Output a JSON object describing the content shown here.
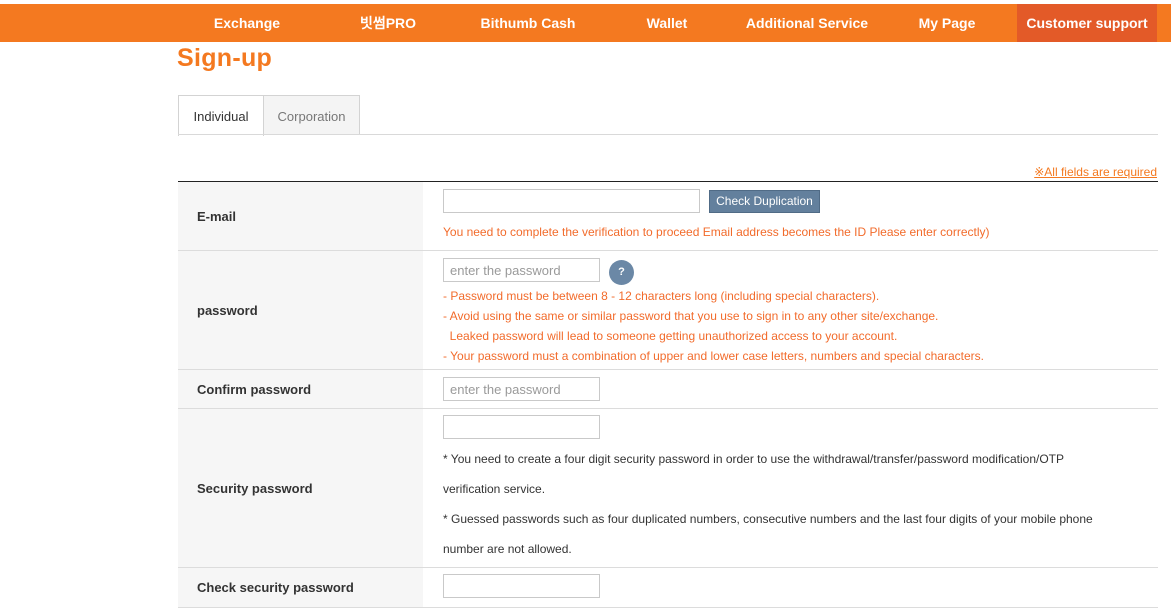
{
  "nav": {
    "items": [
      {
        "label": "Exchange"
      },
      {
        "label": "빗썸PRO"
      },
      {
        "label": "Bithumb Cash"
      },
      {
        "label": "Wallet"
      },
      {
        "label": "Additional Service"
      },
      {
        "label": "My Page"
      },
      {
        "label": "Customer support",
        "active": true
      }
    ]
  },
  "page": {
    "title": "Sign-up"
  },
  "tabs": [
    {
      "label": "Individual",
      "selected": true
    },
    {
      "label": "Corporation",
      "selected": false
    }
  ],
  "required_note": "※All fields are required",
  "form": {
    "email": {
      "label": "E-mail",
      "value": "",
      "check_button": "Check Duplication",
      "hint": "You need to complete the verification to proceed Email address becomes the ID Please enter correctly)"
    },
    "password": {
      "label": "password",
      "placeholder": "enter the password",
      "help_icon": "?",
      "rules": [
        "- Password must be between 8 - 12 characters long (including special characters).",
        "- Avoid using the same or similar password that you use to sign in to any other site/exchange.",
        "  Leaked password will lead to someone getting unauthorized access to your account.",
        "- Your password must a combination of upper and lower case letters, numbers and special characters."
      ]
    },
    "confirm_password": {
      "label": "Confirm password",
      "placeholder": "enter the password"
    },
    "security_password": {
      "label": "Security password",
      "value": "",
      "notes": [
        "* You need to create a four digit security password in order to use the withdrawal/transfer/password modification/OTP",
        "verification service.",
        "* Guessed passwords such as four duplicated numbers, consecutive numbers and the last four digits of your mobile phone",
        "number are not allowed."
      ]
    },
    "check_security_password": {
      "label": "Check security password",
      "value": ""
    }
  },
  "colors": {
    "brand": "#f47920",
    "nav_active": "#e35a28",
    "button": "#63809d",
    "warning": "#f26b2b"
  }
}
